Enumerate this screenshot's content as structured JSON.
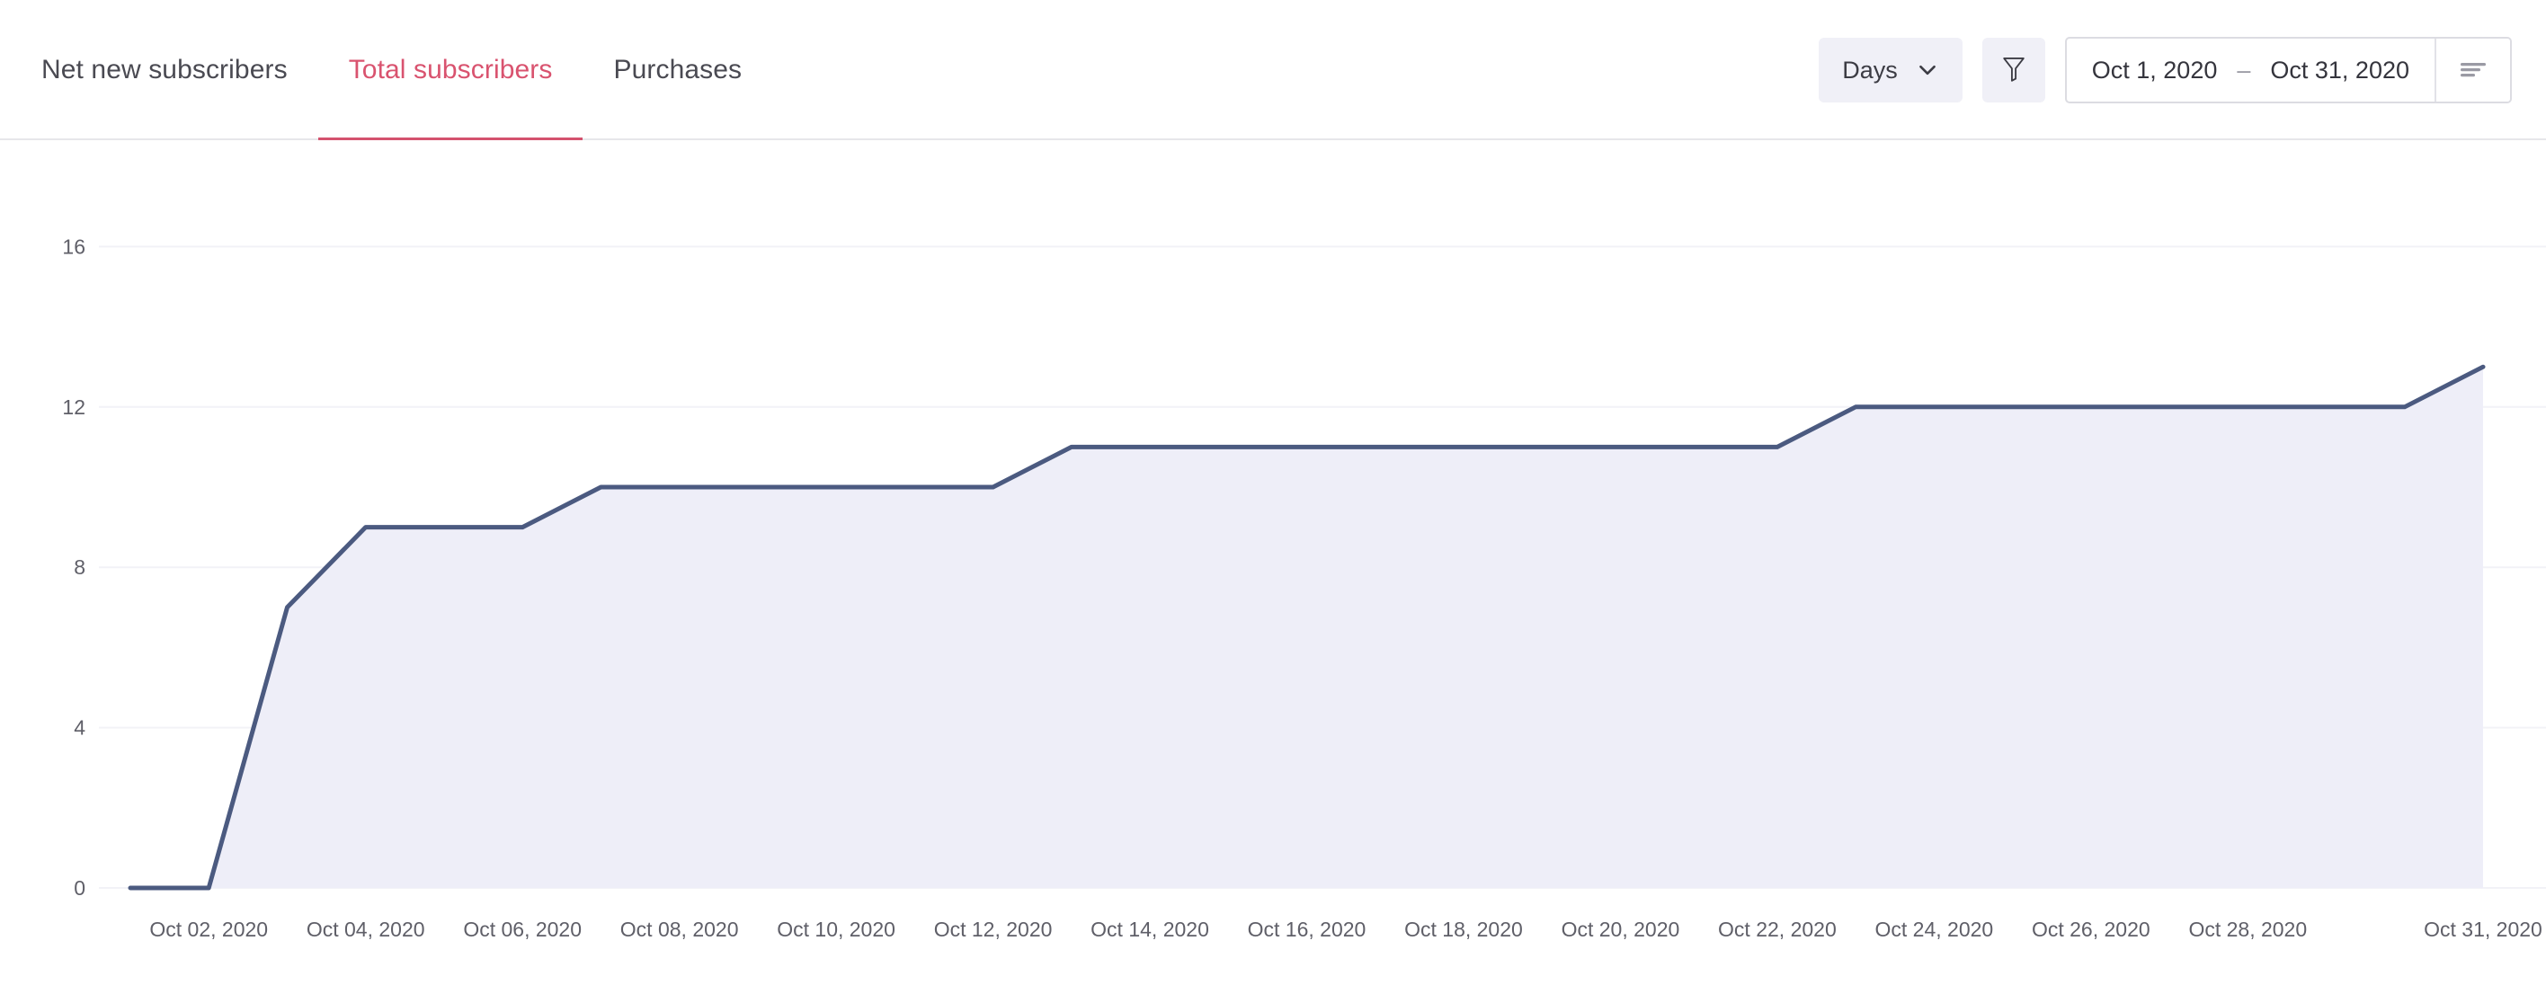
{
  "header": {
    "tabs": [
      {
        "label": "Net new subscribers",
        "active": false
      },
      {
        "label": "Total subscribers",
        "active": true
      },
      {
        "label": "Purchases",
        "active": false
      }
    ],
    "granularity": {
      "label": "Days",
      "icon": "chevron-down-icon"
    },
    "filter": {
      "icon": "filter-funnel-icon"
    },
    "date_range": {
      "start": "Oct 1, 2020",
      "separator": "–",
      "end": "Oct 31, 2020",
      "sort_icon": "sort-lines-icon"
    }
  },
  "colors": {
    "accent_rose": "#d9536f",
    "tab_underline": "#d4526e",
    "line_stroke": "#4b5a80",
    "area_fill": "#eeeef8",
    "gridline": "#f2f2f7",
    "control_bg": "#f0f0f7",
    "text_primary": "#4a4a52",
    "tick_text": "#5f5f68"
  },
  "chart_data": {
    "type": "area",
    "title": "Total subscribers",
    "xlabel": "",
    "ylabel": "",
    "grid": true,
    "legend": false,
    "ylim": [
      0,
      18
    ],
    "yticks": [
      0,
      4,
      8,
      12,
      16
    ],
    "x": [
      "Oct 01, 2020",
      "Oct 02, 2020",
      "Oct 03, 2020",
      "Oct 04, 2020",
      "Oct 05, 2020",
      "Oct 06, 2020",
      "Oct 07, 2020",
      "Oct 08, 2020",
      "Oct 09, 2020",
      "Oct 10, 2020",
      "Oct 11, 2020",
      "Oct 12, 2020",
      "Oct 13, 2020",
      "Oct 14, 2020",
      "Oct 15, 2020",
      "Oct 16, 2020",
      "Oct 17, 2020",
      "Oct 18, 2020",
      "Oct 19, 2020",
      "Oct 20, 2020",
      "Oct 21, 2020",
      "Oct 22, 2020",
      "Oct 23, 2020",
      "Oct 24, 2020",
      "Oct 25, 2020",
      "Oct 26, 2020",
      "Oct 27, 2020",
      "Oct 28, 2020",
      "Oct 29, 2020",
      "Oct 30, 2020",
      "Oct 31, 2020"
    ],
    "xtick_labels": [
      "Oct 02, 2020",
      "Oct 04, 2020",
      "Oct 06, 2020",
      "Oct 08, 2020",
      "Oct 10, 2020",
      "Oct 12, 2020",
      "Oct 14, 2020",
      "Oct 16, 2020",
      "Oct 18, 2020",
      "Oct 20, 2020",
      "Oct 22, 2020",
      "Oct 24, 2020",
      "Oct 26, 2020",
      "Oct 28, 2020",
      "Oct 31, 2020"
    ],
    "xtick_indices": [
      1,
      3,
      5,
      7,
      9,
      11,
      13,
      15,
      17,
      19,
      21,
      23,
      25,
      27,
      30
    ],
    "series": [
      {
        "name": "Total subscribers",
        "values": [
          0,
          0,
          7,
          9,
          9,
          9,
          10,
          10,
          10,
          10,
          10,
          10,
          11,
          11,
          11,
          11,
          11,
          11,
          11,
          11,
          11,
          11,
          12,
          12,
          12,
          12,
          12,
          12,
          12,
          12,
          13
        ]
      }
    ]
  }
}
